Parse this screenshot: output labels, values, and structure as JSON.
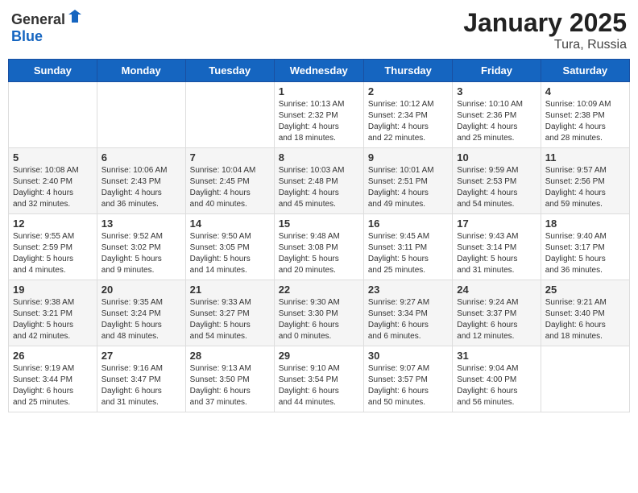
{
  "header": {
    "logo_general": "General",
    "logo_blue": "Blue",
    "month_year": "January 2025",
    "location": "Tura, Russia"
  },
  "weekdays": [
    "Sunday",
    "Monday",
    "Tuesday",
    "Wednesday",
    "Thursday",
    "Friday",
    "Saturday"
  ],
  "weeks": [
    [
      {
        "day": "",
        "info": ""
      },
      {
        "day": "",
        "info": ""
      },
      {
        "day": "",
        "info": ""
      },
      {
        "day": "1",
        "info": "Sunrise: 10:13 AM\nSunset: 2:32 PM\nDaylight: 4 hours\nand 18 minutes."
      },
      {
        "day": "2",
        "info": "Sunrise: 10:12 AM\nSunset: 2:34 PM\nDaylight: 4 hours\nand 22 minutes."
      },
      {
        "day": "3",
        "info": "Sunrise: 10:10 AM\nSunset: 2:36 PM\nDaylight: 4 hours\nand 25 minutes."
      },
      {
        "day": "4",
        "info": "Sunrise: 10:09 AM\nSunset: 2:38 PM\nDaylight: 4 hours\nand 28 minutes."
      }
    ],
    [
      {
        "day": "5",
        "info": "Sunrise: 10:08 AM\nSunset: 2:40 PM\nDaylight: 4 hours\nand 32 minutes."
      },
      {
        "day": "6",
        "info": "Sunrise: 10:06 AM\nSunset: 2:43 PM\nDaylight: 4 hours\nand 36 minutes."
      },
      {
        "day": "7",
        "info": "Sunrise: 10:04 AM\nSunset: 2:45 PM\nDaylight: 4 hours\nand 40 minutes."
      },
      {
        "day": "8",
        "info": "Sunrise: 10:03 AM\nSunset: 2:48 PM\nDaylight: 4 hours\nand 45 minutes."
      },
      {
        "day": "9",
        "info": "Sunrise: 10:01 AM\nSunset: 2:51 PM\nDaylight: 4 hours\nand 49 minutes."
      },
      {
        "day": "10",
        "info": "Sunrise: 9:59 AM\nSunset: 2:53 PM\nDaylight: 4 hours\nand 54 minutes."
      },
      {
        "day": "11",
        "info": "Sunrise: 9:57 AM\nSunset: 2:56 PM\nDaylight: 4 hours\nand 59 minutes."
      }
    ],
    [
      {
        "day": "12",
        "info": "Sunrise: 9:55 AM\nSunset: 2:59 PM\nDaylight: 5 hours\nand 4 minutes."
      },
      {
        "day": "13",
        "info": "Sunrise: 9:52 AM\nSunset: 3:02 PM\nDaylight: 5 hours\nand 9 minutes."
      },
      {
        "day": "14",
        "info": "Sunrise: 9:50 AM\nSunset: 3:05 PM\nDaylight: 5 hours\nand 14 minutes."
      },
      {
        "day": "15",
        "info": "Sunrise: 9:48 AM\nSunset: 3:08 PM\nDaylight: 5 hours\nand 20 minutes."
      },
      {
        "day": "16",
        "info": "Sunrise: 9:45 AM\nSunset: 3:11 PM\nDaylight: 5 hours\nand 25 minutes."
      },
      {
        "day": "17",
        "info": "Sunrise: 9:43 AM\nSunset: 3:14 PM\nDaylight: 5 hours\nand 31 minutes."
      },
      {
        "day": "18",
        "info": "Sunrise: 9:40 AM\nSunset: 3:17 PM\nDaylight: 5 hours\nand 36 minutes."
      }
    ],
    [
      {
        "day": "19",
        "info": "Sunrise: 9:38 AM\nSunset: 3:21 PM\nDaylight: 5 hours\nand 42 minutes."
      },
      {
        "day": "20",
        "info": "Sunrise: 9:35 AM\nSunset: 3:24 PM\nDaylight: 5 hours\nand 48 minutes."
      },
      {
        "day": "21",
        "info": "Sunrise: 9:33 AM\nSunset: 3:27 PM\nDaylight: 5 hours\nand 54 minutes."
      },
      {
        "day": "22",
        "info": "Sunrise: 9:30 AM\nSunset: 3:30 PM\nDaylight: 6 hours\nand 0 minutes."
      },
      {
        "day": "23",
        "info": "Sunrise: 9:27 AM\nSunset: 3:34 PM\nDaylight: 6 hours\nand 6 minutes."
      },
      {
        "day": "24",
        "info": "Sunrise: 9:24 AM\nSunset: 3:37 PM\nDaylight: 6 hours\nand 12 minutes."
      },
      {
        "day": "25",
        "info": "Sunrise: 9:21 AM\nSunset: 3:40 PM\nDaylight: 6 hours\nand 18 minutes."
      }
    ],
    [
      {
        "day": "26",
        "info": "Sunrise: 9:19 AM\nSunset: 3:44 PM\nDaylight: 6 hours\nand 25 minutes."
      },
      {
        "day": "27",
        "info": "Sunrise: 9:16 AM\nSunset: 3:47 PM\nDaylight: 6 hours\nand 31 minutes."
      },
      {
        "day": "28",
        "info": "Sunrise: 9:13 AM\nSunset: 3:50 PM\nDaylight: 6 hours\nand 37 minutes."
      },
      {
        "day": "29",
        "info": "Sunrise: 9:10 AM\nSunset: 3:54 PM\nDaylight: 6 hours\nand 44 minutes."
      },
      {
        "day": "30",
        "info": "Sunrise: 9:07 AM\nSunset: 3:57 PM\nDaylight: 6 hours\nand 50 minutes."
      },
      {
        "day": "31",
        "info": "Sunrise: 9:04 AM\nSunset: 4:00 PM\nDaylight: 6 hours\nand 56 minutes."
      },
      {
        "day": "",
        "info": ""
      }
    ]
  ]
}
